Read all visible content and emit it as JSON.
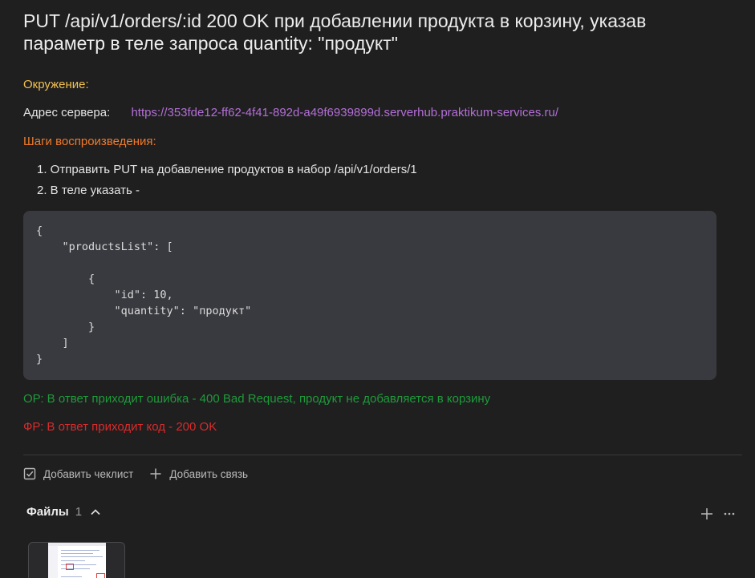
{
  "issue": {
    "title": "PUT /api/v1/orders/:id 200 OK при добавлении продукта в корзину, указав параметр в теле запроса quantity: \"продукт\""
  },
  "environment": {
    "label": "Окружение:",
    "server_label": "Адрес сервера:",
    "server_url": "https://353fde12-ff62-4f41-892d-a49f6939899d.serverhub.praktikum-services.ru/"
  },
  "steps": {
    "label": "Шаги воспроизведения:",
    "items": [
      "1. Отправить PUT на добавление продуктов в набор /api/v1/orders/1",
      "2. В теле указать -"
    ]
  },
  "code": "{\n    \"productsList\": [\n\n        {\n            \"id\": 10,\n            \"quantity\": \"продукт\"\n        }\n    ]\n}",
  "expected": "ОР: В ответ приходит ошибка - 400 Bad Request, продукт не добавляется в корзину",
  "actual": "ФР: В ответ приходит код - 200 OK",
  "actions": {
    "checklist_label": "Добавить чеклист",
    "link_label": "Добавить связь"
  },
  "files": {
    "label": "Файлы",
    "count": "1"
  },
  "colors": {
    "environment": "#f2c14e",
    "steps": "#f07a2a",
    "link": "#b46fd6",
    "expected": "#1f9a3a",
    "actual": "#d92b2b",
    "code_background": "#393a3f",
    "page_background": "#1f1f20"
  },
  "icons": {
    "checklist": "checkbox-icon",
    "link": "plus-icon",
    "files_toggle": "chevron-up-icon",
    "files_add": "plus-icon",
    "files_more": "more-horizontal-icon"
  }
}
